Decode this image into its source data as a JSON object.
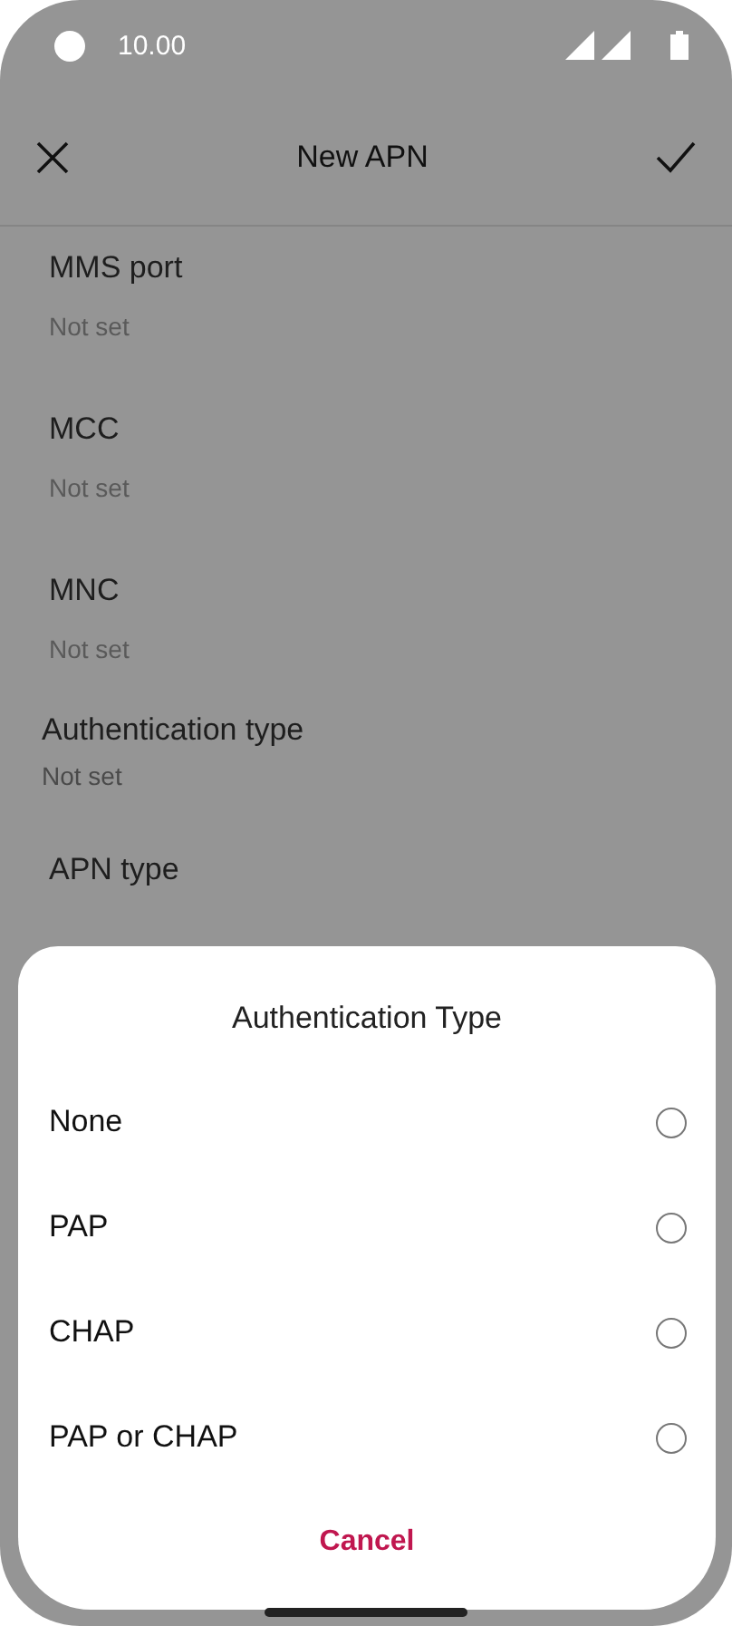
{
  "status_bar": {
    "time": "10.00"
  },
  "toolbar": {
    "title": "New APN"
  },
  "settings": [
    {
      "label": "MMS port",
      "value": "Not set"
    },
    {
      "label": "MCC",
      "value": "Not set"
    },
    {
      "label": "MNC",
      "value": "Not set"
    },
    {
      "label": "Authentication type",
      "value": "Not set"
    },
    {
      "label": "APN type"
    }
  ],
  "dialog": {
    "title": "Authentication Type",
    "options": [
      {
        "label": "None",
        "selected": false
      },
      {
        "label": "PAP",
        "selected": false
      },
      {
        "label": "CHAP",
        "selected": false
      },
      {
        "label": "PAP or CHAP",
        "selected": false
      }
    ],
    "cancel": "Cancel"
  }
}
